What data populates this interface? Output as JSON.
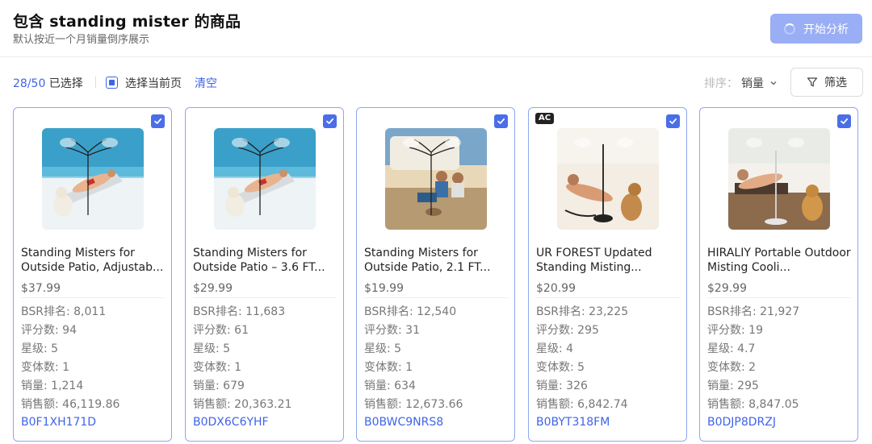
{
  "header": {
    "title": "包含 standing mister 的商品",
    "subtitle": "默认按近一个月销量倒序展示",
    "analyze_label": "开始分析"
  },
  "toolbar": {
    "selected": "28/50",
    "selected_suffix": " 已选择",
    "select_page_label": "选择当前页",
    "clear_label": "清空",
    "sort_prefix": "排序：",
    "sort_value": "销量",
    "filter_label": "筛选"
  },
  "colors": {
    "accent": "#3f64e8",
    "card_border": "#8fa7f0",
    "analyze_button": "#99aef5"
  },
  "products": [
    {
      "title": "Standing Misters for Outside Patio, Adjustab...",
      "price": "$37.99",
      "bsr": "BSR排名: 8,011",
      "reviews": "评分数: 94",
      "rating": "星级: 5",
      "variants": "变体数: 1",
      "sales": "销量: 1,214",
      "revenue": "销售额: 46,119.86",
      "asin": "B0F1XH171D",
      "badge": "",
      "checked": true,
      "image_scene": "pool"
    },
    {
      "title": "Standing Misters for Outside Patio – 3.6 FT...",
      "price": "$29.99",
      "bsr": "BSR排名: 11,683",
      "reviews": "评分数: 61",
      "rating": "星级: 5",
      "variants": "变体数: 1",
      "sales": "销量: 679",
      "revenue": "销售额: 20,363.21",
      "asin": "B0DX6C6YHF",
      "badge": "",
      "checked": true,
      "image_scene": "pool"
    },
    {
      "title": "Standing Misters for Outside Patio, 2.1 FT...",
      "price": "$19.99",
      "bsr": "BSR排名: 12,540",
      "reviews": "评分数: 31",
      "rating": "星级: 5",
      "variants": "变体数: 1",
      "sales": "销量: 634",
      "revenue": "销售额: 12,673.66",
      "asin": "B0BWC9NRS8",
      "badge": "",
      "checked": true,
      "image_scene": "camp"
    },
    {
      "title": "UR FOREST Updated Standing Misting...",
      "price": "$20.99",
      "bsr": "BSR排名: 23,225",
      "reviews": "评分数: 295",
      "rating": "星级: 4",
      "variants": "变体数: 5",
      "sales": "销量: 326",
      "revenue": "销售额: 6,842.74",
      "asin": "B0BYT318FM",
      "badge": "AC",
      "checked": true,
      "image_scene": "beach"
    },
    {
      "title": "HIRALIY Portable Outdoor Misting Cooli...",
      "price": "$29.99",
      "bsr": "BSR排名: 21,927",
      "reviews": "评分数: 19",
      "rating": "星级: 4.7",
      "variants": "变体数: 2",
      "sales": "销量: 295",
      "revenue": "销售额: 8,847.05",
      "asin": "B0DJP8DRZJ",
      "badge": "",
      "checked": true,
      "image_scene": "deck"
    }
  ]
}
